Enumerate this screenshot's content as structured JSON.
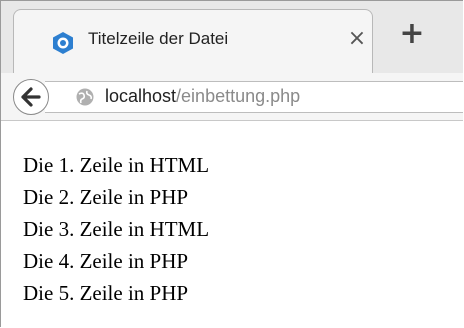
{
  "tab": {
    "title": "Titelzeile der Datei",
    "favicon": "app-logo-icon",
    "close_icon": "×",
    "new_tab_icon": "+"
  },
  "navbar": {
    "back_icon": "back-arrow-icon",
    "site_icon": "globe-icon",
    "url_host": "localhost",
    "url_path": "/einbettung.php"
  },
  "content": {
    "lines": [
      "Die 1. Zeile in HTML",
      "Die 2. Zeile in PHP",
      "Die 3. Zeile in HTML",
      "Die 4. Zeile in PHP",
      "Die 5. Zeile in PHP"
    ]
  },
  "colors": {
    "favicon_blue": "#2d7fd0",
    "url_path_gray": "#8a8a8a",
    "tab_bg": "#f5f5f5"
  }
}
